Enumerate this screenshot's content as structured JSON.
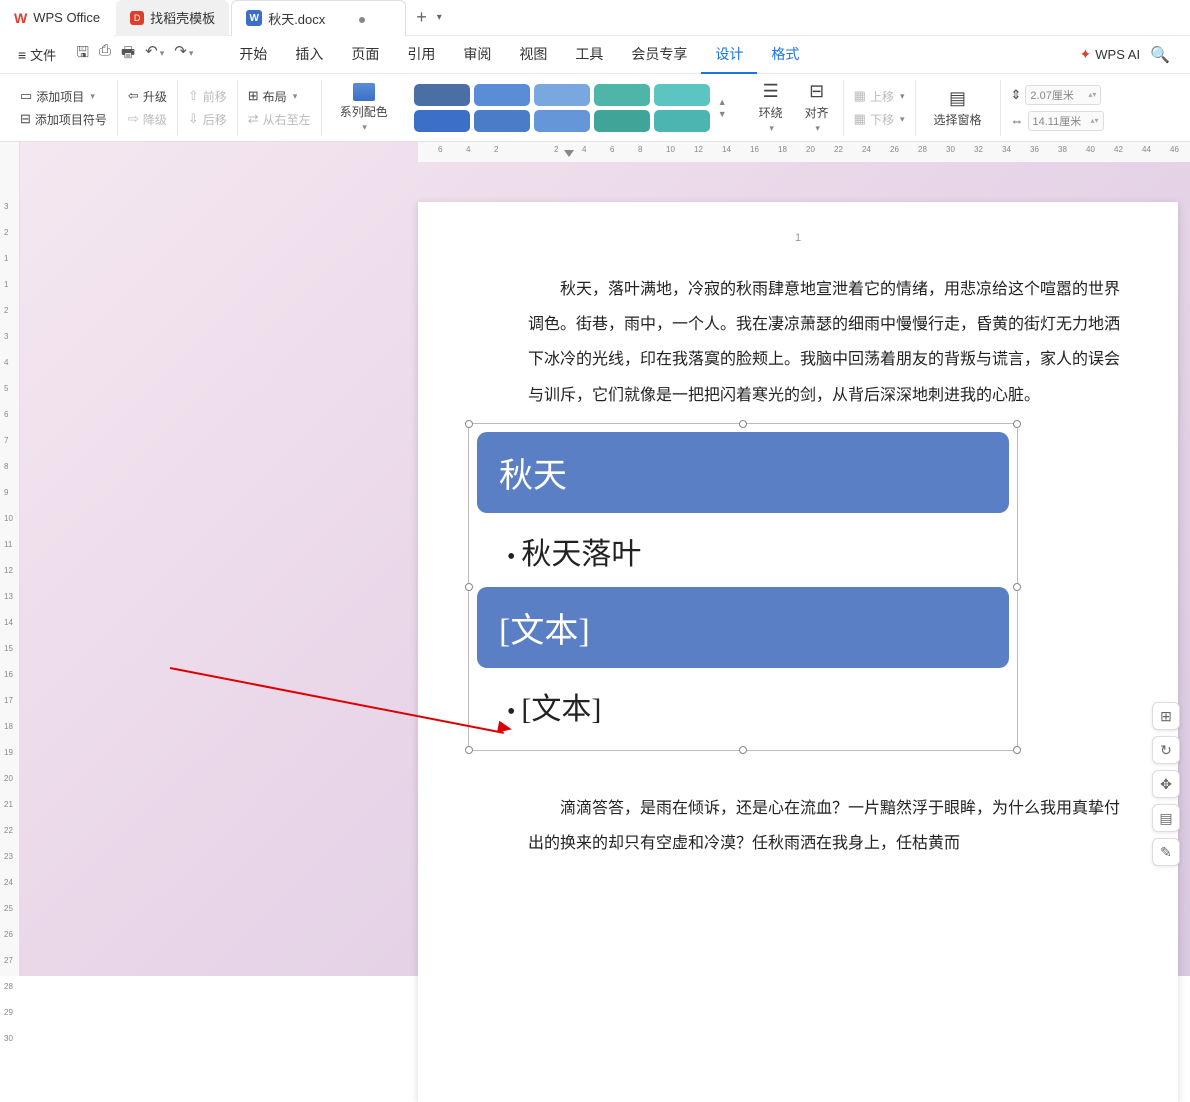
{
  "titlebar": {
    "app_name": "WPS Office",
    "template_tab": "找稻壳模板",
    "doc_tab": "秋天.docx"
  },
  "menubar": {
    "file": "文件",
    "tabs": [
      "开始",
      "插入",
      "页面",
      "引用",
      "审阅",
      "视图",
      "工具",
      "会员专享",
      "设计",
      "格式"
    ],
    "ai": "WPS AI"
  },
  "ribbon": {
    "add_item": "添加项目",
    "add_bullet": "添加项目符号",
    "upgrade": "升级",
    "downgrade": "降级",
    "move_forward": "前移",
    "move_back": "后移",
    "layout": "布局",
    "rtl": "从右至左",
    "series_color": "系列配色",
    "wrap": "环绕",
    "align": "对齐",
    "move_up": "上移",
    "move_down": "下移",
    "select_pane": "选择窗格",
    "width_val": "2.07厘米",
    "height_val": "14.11厘米"
  },
  "document": {
    "page_number": "1",
    "para1": "秋天，落叶满地，冷寂的秋雨肆意地宣泄着它的情绪，用悲凉给这个喧嚣的世界调色。街巷，雨中，一个人。我在凄凉萧瑟的细雨中慢慢行走，昏黄的街灯无力地洒下冰冷的光线，印在我落寞的脸颊上。我脑中回荡着朋友的背叛与谎言，家人的误会与训斥，它们就像是一把把闪着寒光的剑，从背后深深地刺进我的心脏。",
    "para2": "滴滴答答，是雨在倾诉，还是心在流血？一片黯然浮于眼眸，为什么我用真挚付出的换来的却只有空虚和冷漠？任秋雨洒在我身上，任枯黄而",
    "smartart": {
      "block1": "秋天",
      "bullet1": "秋天落叶",
      "block2": "[文本]",
      "bullet2": "[文本]"
    }
  },
  "hruler_ticks": [
    "6",
    "4",
    "2",
    "2",
    "4",
    "6",
    "8",
    "10",
    "12",
    "14",
    "16",
    "18",
    "20",
    "22",
    "24",
    "26",
    "28",
    "30",
    "32",
    "34",
    "36",
    "38",
    "40",
    "42",
    "44",
    "46"
  ],
  "vruler_ticks": [
    "3",
    "2",
    "1",
    "1",
    "2",
    "3",
    "4",
    "5",
    "6",
    "7",
    "8",
    "9",
    "10",
    "11",
    "12",
    "13",
    "14",
    "15",
    "16",
    "17",
    "18",
    "19",
    "20",
    "21",
    "22",
    "23",
    "24",
    "25",
    "26",
    "27",
    "28",
    "29",
    "30"
  ]
}
